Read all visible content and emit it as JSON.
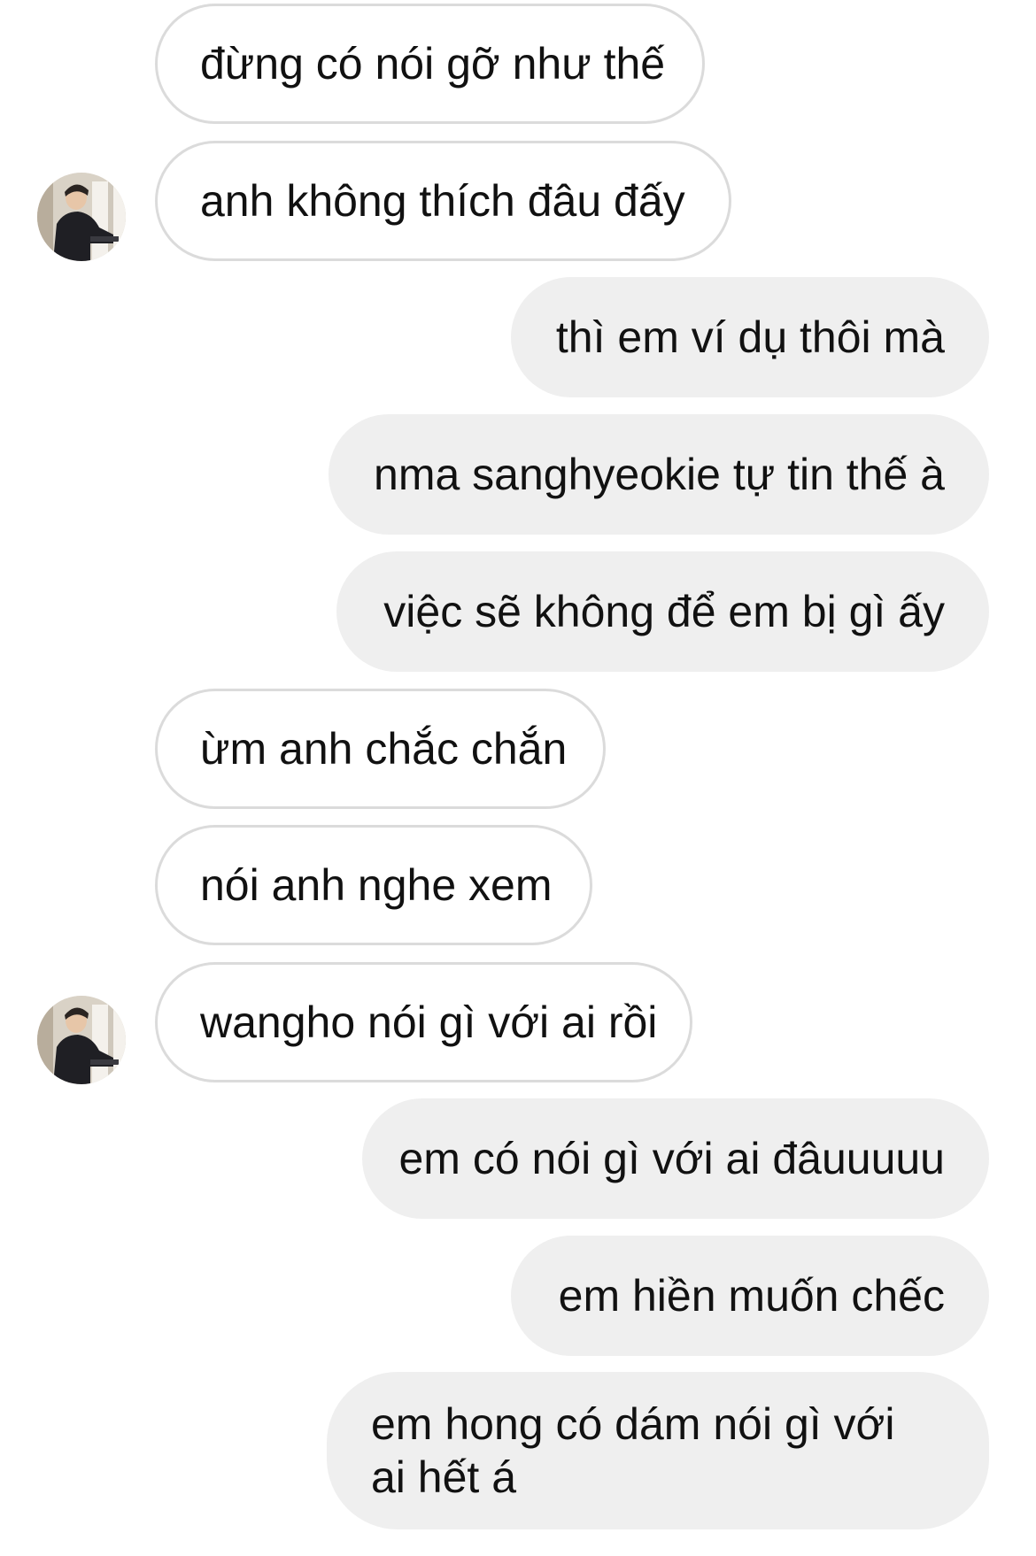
{
  "messages": [
    {
      "direction": "in",
      "text": "đừng có nói gỡ như thế",
      "avatar": false
    },
    {
      "direction": "in",
      "text": "anh không thích đâu đấy",
      "avatar": true
    },
    {
      "direction": "out",
      "text": "thì em ví dụ thôi mà"
    },
    {
      "direction": "out",
      "text": "nma sanghyeokie tự tin thế à"
    },
    {
      "direction": "out",
      "text": "việc sẽ không để em bị gì ấy"
    },
    {
      "direction": "in",
      "text": "ừm anh chắc chắn",
      "avatar": false
    },
    {
      "direction": "in",
      "text": "nói anh nghe xem",
      "avatar": false
    },
    {
      "direction": "in",
      "text": "wangho nói gì với ai rồi",
      "avatar": true
    },
    {
      "direction": "out",
      "text": "em có nói gì với ai đâuuuuu"
    },
    {
      "direction": "out",
      "text": "em hiền muốn chếc"
    },
    {
      "direction": "out",
      "text": "em hong có dám nói gì với ai hết á"
    }
  ],
  "avatar_icon": "user-photo",
  "colors": {
    "incoming_bubble_bg": "#ffffff",
    "incoming_bubble_border": "#dbdbdb",
    "outgoing_bubble_bg": "#efefef",
    "text": "#111111"
  }
}
